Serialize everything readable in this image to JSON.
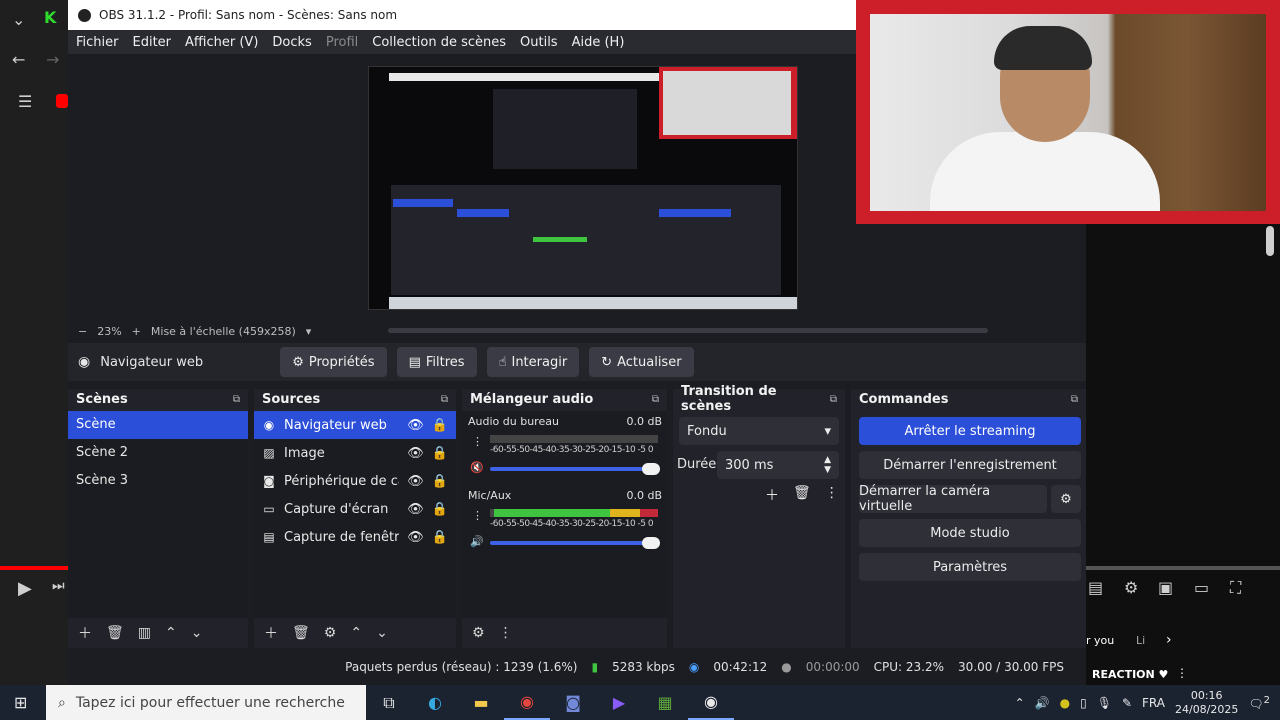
{
  "window": {
    "title": "OBS 31.1.2 - Profil: Sans nom - Scènes: Sans nom"
  },
  "menu": [
    "Fichier",
    "Editer",
    "Afficher (V)",
    "Docks",
    "Profil",
    "Collection de scènes",
    "Outils",
    "Aide (H)"
  ],
  "preview": {
    "zoom": "23%",
    "scale_label": "Mise à l'échelle (459x258)"
  },
  "source_toolbar": {
    "selected_source": "Navigateur web",
    "buttons": [
      "Propriétés",
      "Filtres",
      "Interagir",
      "Actualiser"
    ]
  },
  "scenes": {
    "title": "Scènes",
    "items": [
      "Scène",
      "Scène 2",
      "Scène 3"
    ]
  },
  "sources": {
    "title": "Sources",
    "items": [
      "Navigateur web",
      "Image",
      "Périphérique de capt",
      "Capture d'écran",
      "Capture de fenêtre"
    ]
  },
  "mixer": {
    "title": "Mélangeur audio",
    "channels": [
      {
        "name": "Audio du bureau",
        "db": "0.0 dB"
      },
      {
        "name": "Mic/Aux",
        "db": "0.0 dB"
      }
    ],
    "scale": "-60-55-50-45-40-35-30-25-20-15-10 -5  0"
  },
  "transitions": {
    "title": "Transition de scènes",
    "type": "Fondu",
    "duration_label": "Durée",
    "duration_value": "300 ms"
  },
  "controls": {
    "title": "Commandes",
    "buttons": [
      "Arrêter le streaming",
      "Démarrer l'enregistrement",
      "Démarrer la caméra virtuelle",
      "Mode studio",
      "Paramètres"
    ]
  },
  "status": {
    "dropped": "Paquets perdus (réseau) : 1239 (1.6%)",
    "bitrate": "5283 kbps",
    "stream_time": "00:42:12",
    "rec_time": "00:00:00",
    "cpu": "CPU: 23.2%",
    "fps": "30.00 / 30.00 FPS"
  },
  "browser": {
    "sidebar_text": "r you",
    "chip": "Li",
    "reaction": "REACTION ♥"
  },
  "taskbar": {
    "search_placeholder": "Tapez ici pour effectuer une recherche",
    "language": "FRA",
    "time": "00:16",
    "date": "24/08/2025",
    "notifications": "2"
  },
  "colors": {
    "accent": "#2b4fd8",
    "webcam_border": "#cc1f2a",
    "meter_green": "#3ec43e",
    "meter_yellow": "#e0b41c",
    "meter_red": "#c22a3a"
  }
}
